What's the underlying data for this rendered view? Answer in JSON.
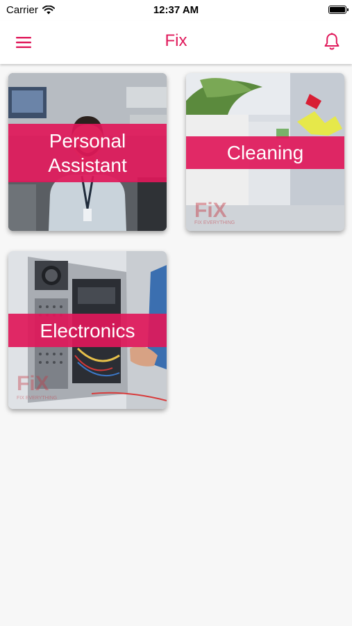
{
  "status_bar": {
    "carrier": "Carrier",
    "time": "12:37 AM"
  },
  "header": {
    "title": "Fix"
  },
  "categories": [
    {
      "label": "Personal Assistant"
    },
    {
      "label": "Cleaning"
    },
    {
      "label": "Electronics"
    }
  ],
  "colors": {
    "accent": "#e0185a"
  },
  "icons": {
    "menu": "hamburger-icon",
    "notifications": "bell-icon",
    "wifi": "wifi-icon"
  }
}
